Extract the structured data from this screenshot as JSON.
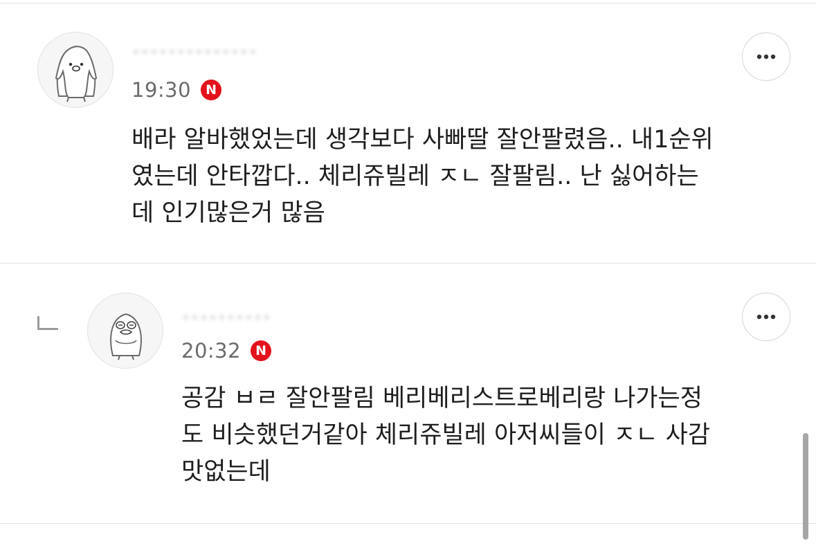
{
  "comments": [
    {
      "nickname": "••••••••••••••",
      "time": "19:30",
      "badge": "N",
      "text_lines": [
        "배라 알바했었는데 생각보다 사빠딸 잘안팔렸음.. 내1순위",
        "였는데 안타깝다.. 체리쥬빌레 ㅈㄴ 잘팔림.. 난 싫어하는",
        "데 인기많은거 많음"
      ],
      "avatar_icon": "penguin-icon"
    },
    {
      "nickname": "••••••••••",
      "time": "20:32",
      "badge": "N",
      "text_lines": [
        "공감 ㅂㄹ 잘안팔림 베리베리스트로베리랑 나가는정",
        "도 비슷했던거같아 체리쥬빌레 아저씨들이 ㅈㄴ 사감",
        "맛없는데"
      ],
      "avatar_icon": "duck-icon",
      "is_reply": true
    }
  ],
  "more_icon": "more-horizontal-icon",
  "reply_icon": "reply-corner-icon",
  "colors": {
    "badge": "#e3111b",
    "time": "#6b6b6b",
    "text": "#1e1e1e"
  }
}
